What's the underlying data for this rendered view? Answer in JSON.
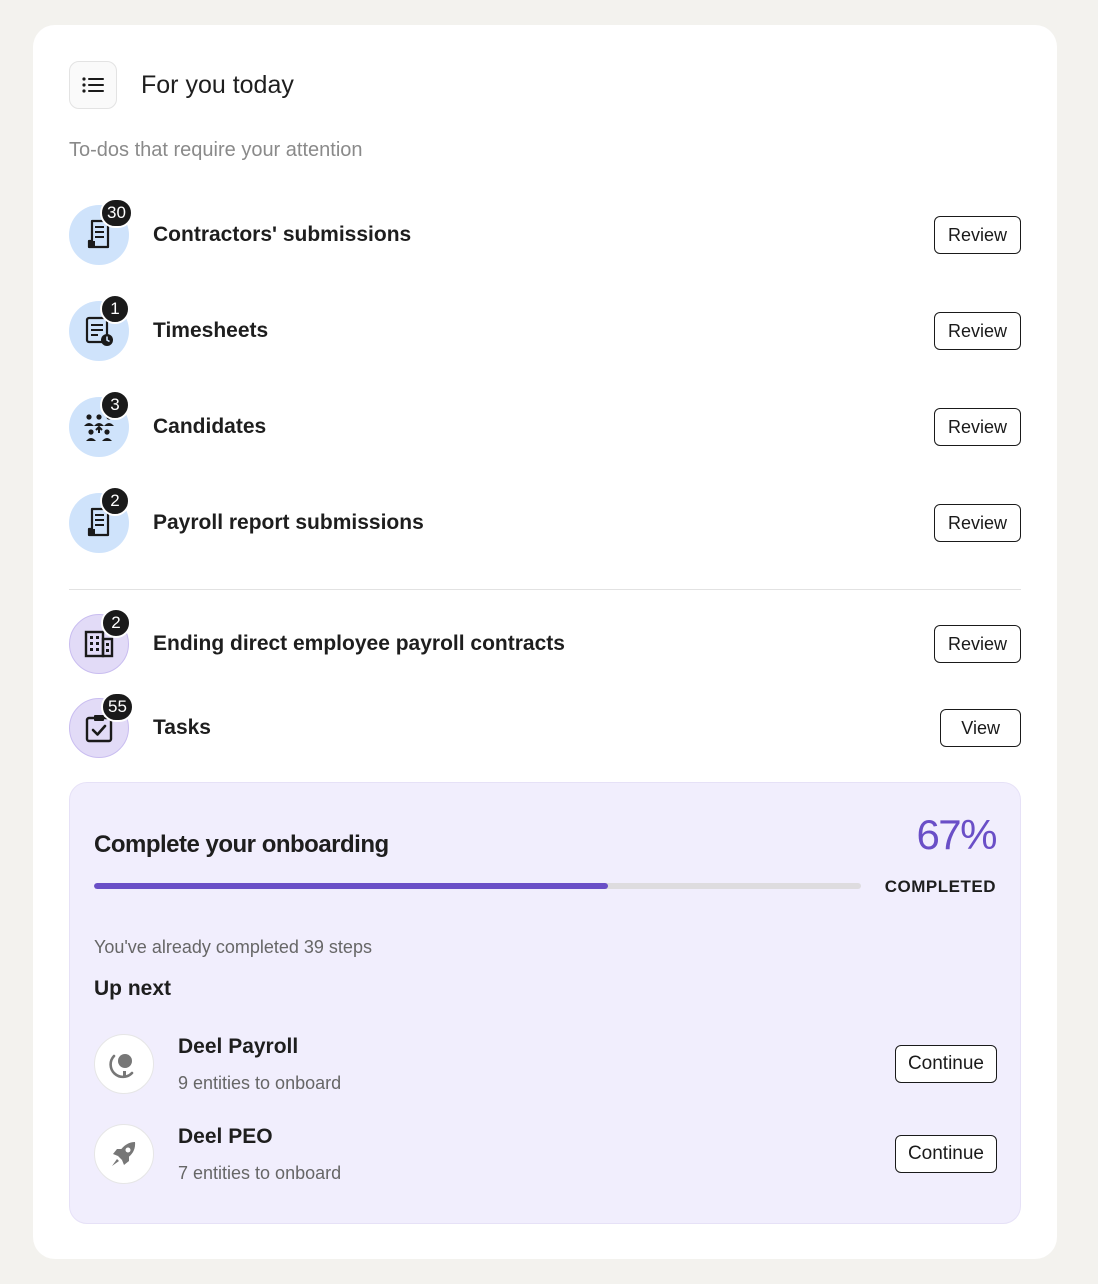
{
  "header": {
    "icon": "list-icon",
    "title": "For you today",
    "subtitle": "To-dos that require your attention"
  },
  "todos": [
    {
      "label": "Contractors' submissions",
      "count": "30",
      "action": "Review",
      "icon": "receipt-icon",
      "tone": "blue"
    },
    {
      "label": "Timesheets",
      "count": "1",
      "action": "Review",
      "icon": "timesheet-icon",
      "tone": "blue"
    },
    {
      "label": "Candidates",
      "count": "3",
      "action": "Review",
      "icon": "people-icon",
      "tone": "blue"
    },
    {
      "label": "Payroll report submissions",
      "count": "2",
      "action": "Review",
      "icon": "receipt-icon",
      "tone": "blue"
    },
    {
      "label": "Ending direct employee payroll contracts",
      "count": "2",
      "action": "Review",
      "icon": "building-icon",
      "tone": "purple"
    },
    {
      "label": "Tasks",
      "count": "55",
      "action": "View",
      "icon": "clipboard-check-icon",
      "tone": "purple"
    }
  ],
  "onboarding": {
    "title": "Complete your onboarding",
    "percent_label": "67%",
    "progress": 0.67,
    "completed_label": "COMPLETED",
    "steps_text": "You've already completed 39 steps",
    "up_next_label": "Up next",
    "items": [
      {
        "name": "Deel Payroll",
        "sub": "9 entities to onboard",
        "action": "Continue",
        "icon": "payroll-globe-icon"
      },
      {
        "name": "Deel PEO",
        "sub": "7 entities to onboard",
        "action": "Continue",
        "icon": "rocket-icon"
      }
    ]
  },
  "colors": {
    "accent": "#6a4fc7",
    "blue_icon_bg": "#cfe3fb",
    "purple_icon_bg": "#e2dbf7",
    "onboarding_bg": "#f1eefd"
  }
}
